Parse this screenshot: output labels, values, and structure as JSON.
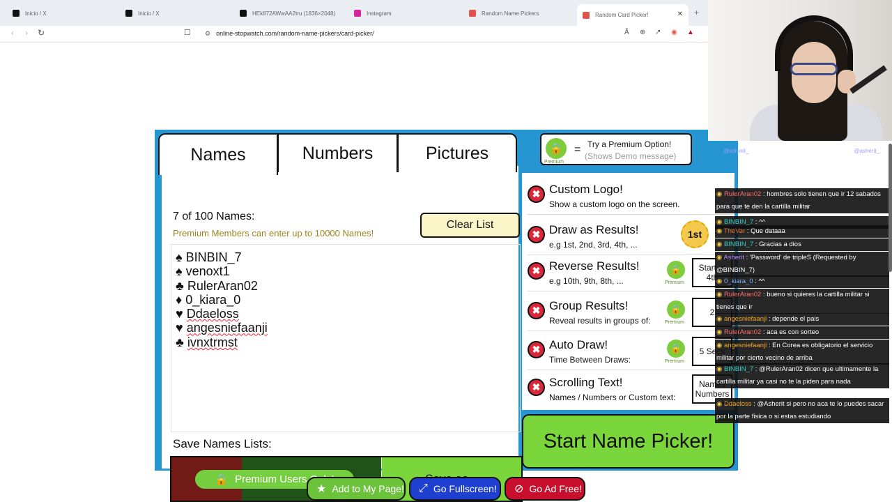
{
  "browser": {
    "tabs": [
      {
        "title": "Inicio / X",
        "fav_color": "#111111"
      },
      {
        "title": "Inicio / X",
        "fav_color": "#111111"
      },
      {
        "title": "HEk872AWwAA2tru (1836×2048)",
        "fav_color": "#111111"
      },
      {
        "title": "Instagram",
        "fav_color": "#d6249f"
      },
      {
        "title": "Random Name Pickers",
        "fav_color": "#e0524a"
      },
      {
        "title": "Random Card Picker!",
        "fav_color": "#e0524a"
      }
    ],
    "close_glyph": "✕",
    "new_tab_glyph": "+",
    "url": "online-stopwatch.com/random-name-pickers/card-picker/"
  },
  "app": {
    "tabs": [
      "Names",
      "Numbers",
      "Pictures"
    ],
    "premium_banner": {
      "line1": "Try a Premium Option!",
      "line2": "(Shows Demo message)",
      "eq": "=",
      "badge_caption": "Premium"
    },
    "names_count": "7 of 100 Names:",
    "premium_note": "Premium Members can enter  up to 10000 Names!",
    "clear_list": "Clear List",
    "names": [
      {
        "suit": "♠",
        "name": "BINBIN_7",
        "underline": false
      },
      {
        "suit": "♠",
        "name": "venoxt1",
        "underline": false
      },
      {
        "suit": "♣",
        "name": "RulerAran02",
        "underline": false
      },
      {
        "suit": "♦",
        "name": "0_kiara_0",
        "underline": false
      },
      {
        "suit": "♥",
        "name": "Ddaeloss",
        "underline": true
      },
      {
        "suit": "♥",
        "name": "angesniefaanji",
        "underline": true
      },
      {
        "suit": "♣",
        "name": "ivnxtrmst",
        "underline": true
      }
    ],
    "save_lists_title": "Save Names Lists:",
    "premium_only": "Premium Users Only!",
    "save_as": "Save as...",
    "options": [
      {
        "title": "Custom Logo!",
        "sub": "Show a custom logo on the screen.",
        "locked": false,
        "value": ""
      },
      {
        "title": "Draw as Results!",
        "sub": "e.g 1st, 2nd, 3rd, 4th, ...",
        "locked": false,
        "value": "",
        "medal": "1st"
      },
      {
        "title": "Reverse Results!",
        "sub": "e.g 10th, 9th, 8th, ...",
        "locked": true,
        "value": "Start at 4th"
      },
      {
        "title": "Group Results!",
        "sub": "Reveal results in groups of:",
        "locked": true,
        "value": "2"
      },
      {
        "title": "Auto Draw!",
        "sub": "Time Between Draws:",
        "locked": true,
        "value": "5 Secs"
      },
      {
        "title": "Scrolling Text!",
        "sub": "Names / Numbers or Custom text:",
        "locked": false,
        "value": "Names Numbers"
      }
    ],
    "lock_caption": "Premium",
    "start": "Start Name Picker!",
    "bottom": {
      "add": "Add to My Page!",
      "fullscreen": "Go Fullscreen!",
      "adfree": "Go Ad Free!"
    }
  },
  "chat": {
    "top_users": [
      "@soherit_",
      "@asherit_"
    ],
    "messages": [
      {
        "user": "RulerAran02",
        "color": "#ff6b6b",
        "text": "hombres solo tienen que ir 12 sabados para que te den la cartilla militar"
      },
      {
        "user": "BINBIN_7",
        "color": "#2fd3c8",
        "text": "^^"
      },
      {
        "user": "TheVar",
        "color": "#e36b2b",
        "text": "Que dataaa"
      },
      {
        "user": "BINBIN_7",
        "color": "#2fd3c8",
        "text": "Gracias a dios"
      },
      {
        "user": "Asherit",
        "color": "#b88bff",
        "text": "'Password' de tripleS (Requested by @BINBIN_7)"
      },
      {
        "user": "0_kiara_0",
        "color": "#7fb3ff",
        "text": "^^"
      },
      {
        "user": "RulerAran02",
        "color": "#ff6b6b",
        "text": "bueno si quieres la cartilla militar si tienes que ir"
      },
      {
        "user": "angesniefaanji",
        "color": "#f6a623",
        "text": "depende el pais"
      },
      {
        "user": "RulerAran02",
        "color": "#ff6b6b",
        "text": "aca es con sorteo"
      },
      {
        "user": "angesniefaanji",
        "color": "#f6a623",
        "text": "En Corea es obligatorio el servicio militar por cierto vecino de arriba"
      },
      {
        "user": "BINBIN_7",
        "color": "#2fd3c8",
        "text": "@RulerAran02 dicen que ultimamente la cartilla militar ya casi no te la piden para nada"
      },
      {
        "user": "Ddaeloss",
        "color": "#f6a623",
        "text": "@Asherit si pero no aca te lo puedes sacar por la parte fisica o si estas estudiando"
      }
    ]
  },
  "colors": {
    "app_blue": "#2596d2",
    "green": "#7ad63a",
    "red_x": "#d9283a",
    "fullscreen_blue": "#1e3fcf",
    "adfree_red": "#c8102e",
    "add_green": "#6cc33b"
  },
  "icons": [
    "lock-icon",
    "star-icon",
    "fullscreen-icon",
    "no-ads-icon",
    "x-icon",
    "reload-icon",
    "bookmark-icon"
  ]
}
